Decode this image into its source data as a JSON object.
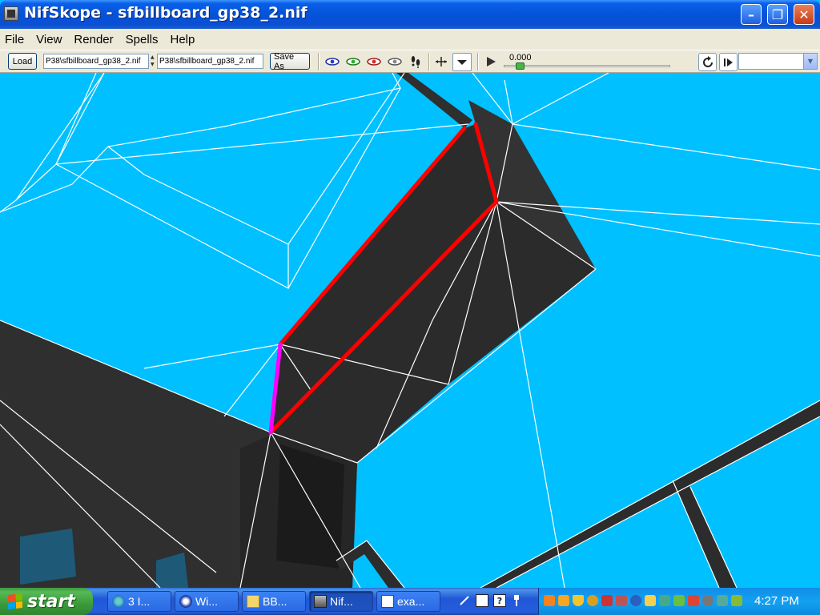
{
  "window": {
    "title": "NifSkope - sfbillboard_gp38_2.nif",
    "minimize_glyph": "–",
    "maximize_glyph": "❐",
    "close_glyph": "✕"
  },
  "menu": {
    "items": [
      {
        "label": "File"
      },
      {
        "label": "View"
      },
      {
        "label": "Render"
      },
      {
        "label": "Spells"
      },
      {
        "label": "Help"
      }
    ]
  },
  "toolbar": {
    "load_label": "Load",
    "load_path": "P38\\sfbillboard_gp38_2.nif",
    "save_path": "P38\\sfbillboard_gp38_2.nif",
    "save_as_label": "Save As",
    "time_value": "0.000",
    "time_slider_fraction": 0.07,
    "icons": [
      "eye-blue-icon",
      "eye-green-icon",
      "eye-red-icon",
      "eye-gray-icon",
      "footprints-icon",
      "axes-icon",
      "view-dropdown-icon",
      "play-icon",
      "loop-icon",
      "step-icon"
    ]
  },
  "taskbar": {
    "start_label": "start",
    "buttons": [
      {
        "label": "3 I...",
        "icon": "ie-icon"
      },
      {
        "label": "Wi...",
        "icon": "media-player-icon"
      },
      {
        "label": "BB...",
        "icon": "folder-icon"
      },
      {
        "label": "Nif...",
        "icon": "nifskope-icon",
        "active": true
      },
      {
        "label": "exa...",
        "icon": "document-icon"
      }
    ],
    "clock": "4:27 PM"
  },
  "colors": {
    "viewport_bg": "#00c0ff",
    "highlight_edge": "#ff0000",
    "selected_edge": "#ff00ff",
    "wireframe": "#ffffff",
    "mesh": "#2e2e2e"
  }
}
